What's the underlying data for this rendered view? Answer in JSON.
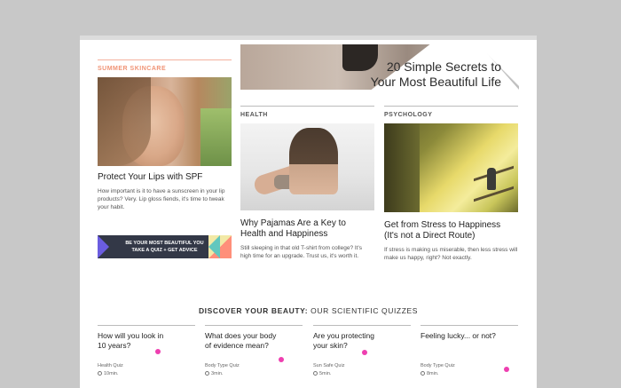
{
  "hero": {
    "title_line1": "20 Simple Secrets to",
    "title_line2": "Your Most Beautiful Life"
  },
  "left": {
    "section": "SUMMER SKINCARE",
    "title": "Protect Your Lips with SPF",
    "text": "How important is it to have a sunscreen in your lip products? Very. Lip gloss fiends, it's time to tweak your habit.",
    "banner_line1": "BE YOUR MOST BEAUTIFUL YOU",
    "banner_line2": "TAKE A QUIZ + GET ADVICE"
  },
  "middle": {
    "section": "HEALTH",
    "title_line1": "Why Pajamas Are a Key to",
    "title_line2": "Health and Happiness",
    "text": "Still sleeping in that old T-shirt from college? It's high time for an upgrade. Trust us, it's worth it."
  },
  "right": {
    "section": "PSYCHOLOGY",
    "title_line1": "Get from Stress to Happiness",
    "title_line2": "(It's not a Direct Route)",
    "text": "If stress is making us miserable, then less stress will make us happy, right? Not exactly."
  },
  "quizzes": {
    "heading_bold": "DISCOVER YOUR BEAUTY:",
    "heading_rest": " OUR SCIENTIFIC QUIZZES",
    "items": [
      {
        "q1": "How will you look in",
        "q2": "10 years?",
        "category": "Health Quiz",
        "time": "10min."
      },
      {
        "q1": "What does your body",
        "q2": "of evidence mean?",
        "category": "Body Type Quiz",
        "time": "3min."
      },
      {
        "q1": "Are you protecting",
        "q2": "your skin?",
        "category": "Sun Safe Quiz",
        "time": "5min."
      },
      {
        "q1": "Feeling lucky... or not?",
        "q2": "",
        "category": "Body Type Quiz",
        "time": "8min."
      }
    ]
  },
  "colors": {
    "accent_coral": "#f09375",
    "dot_magenta": "#ee3fb0",
    "banner_bg": "#333847"
  }
}
